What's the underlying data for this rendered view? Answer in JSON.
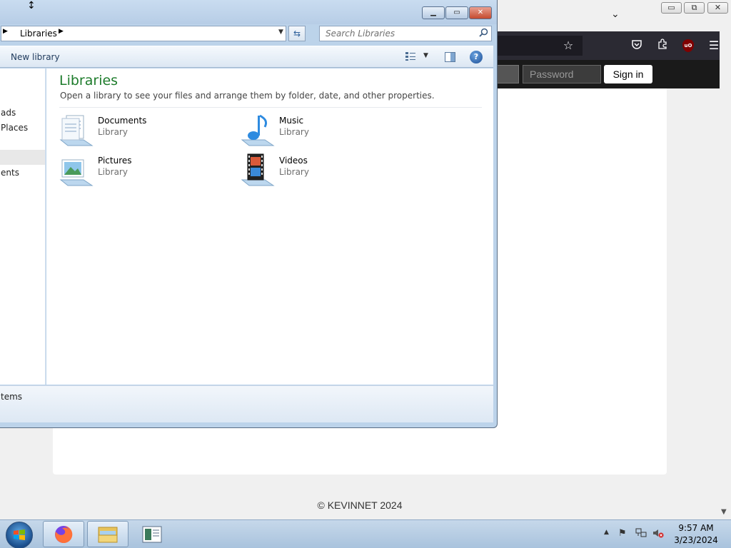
{
  "browser": {
    "window_buttons": [
      "▭",
      "⧉",
      "✕"
    ],
    "password_placeholder": "Password",
    "signin_label": "Sign in",
    "footer": "© KEVINNET 2024"
  },
  "explorer": {
    "address": {
      "crumb": "Libraries"
    },
    "search_placeholder": "Search Libraries",
    "toolbar": {
      "new_library": "New library",
      "help": "?"
    },
    "nav_items": [
      "ads",
      "Places",
      "ents"
    ],
    "title": "Libraries",
    "subtitle": "Open a library to see your files and arrange them by folder, date, and other properties.",
    "libraries": [
      {
        "name": "Documents",
        "type": "Library",
        "icon": "documents-library-icon"
      },
      {
        "name": "Music",
        "type": "Library",
        "icon": "music-library-icon"
      },
      {
        "name": "Pictures",
        "type": "Library",
        "icon": "pictures-library-icon"
      },
      {
        "name": "Videos",
        "type": "Library",
        "icon": "videos-library-icon"
      }
    ],
    "status": "tems"
  },
  "taskbar": {
    "time": "9:57 AM",
    "date": "3/23/2024",
    "apps": [
      "firefox",
      "windows-explorer",
      "document-app"
    ]
  },
  "colors": {
    "library_title": "#1e7c2c",
    "browser_toolbar": "#2b2a33",
    "site_header": "#1a1a1a"
  }
}
